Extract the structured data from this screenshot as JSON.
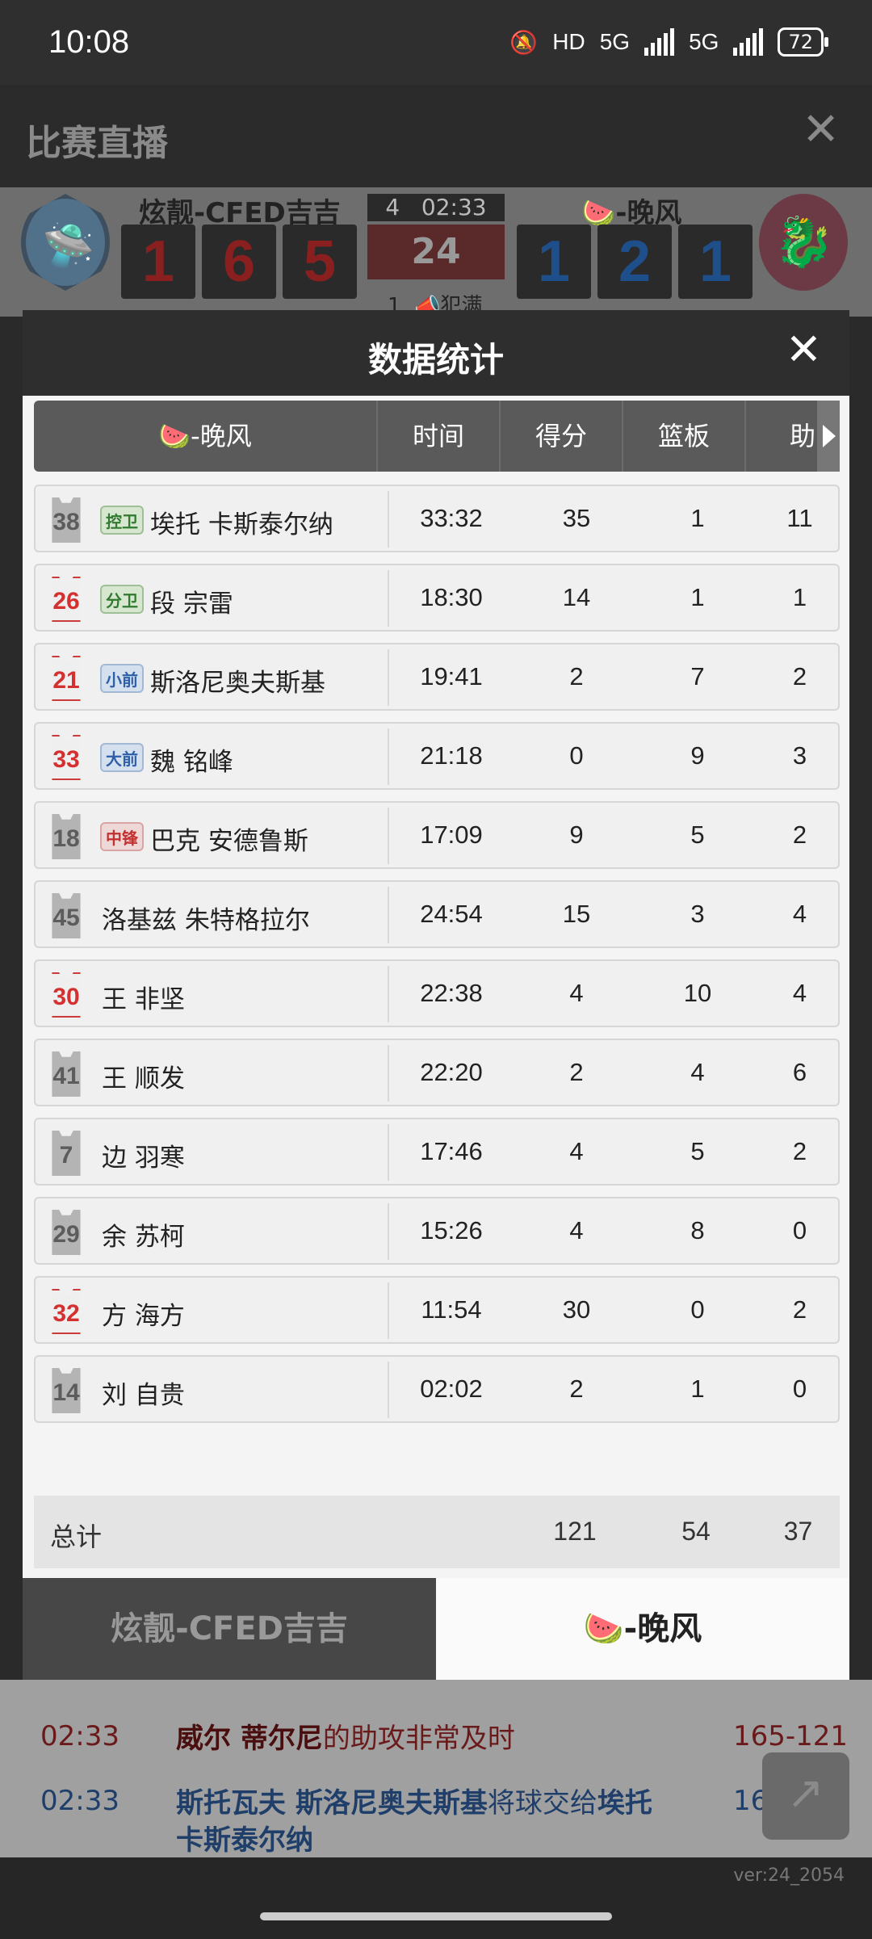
{
  "status_bar": {
    "time": "10:08",
    "icons": [
      "mute-icon",
      "hd-icon",
      "5g-signal-icon",
      "5g-signal-icon"
    ],
    "hd": "HD",
    "net1": "5G",
    "net2": "5G",
    "battery": "72"
  },
  "app": {
    "title": "比赛直播",
    "close_icon": "✕"
  },
  "scoreboard": {
    "home_name": "炫靓-CFED吉吉",
    "away_name": "🍉-晚风",
    "home_digits": [
      "1",
      "6",
      "5"
    ],
    "away_digits": [
      "1",
      "2",
      "1"
    ],
    "quarter": "4",
    "clock": "02:33",
    "shot_clock": "24",
    "foul_count": "1",
    "foul_label": "犯满"
  },
  "modal": {
    "title": "数据统计",
    "close_icon": "✕",
    "table": {
      "team_header": "🍉-晚风",
      "columns": [
        "时间",
        "得分",
        "篮板",
        "助"
      ],
      "rows": [
        {
          "number": "38",
          "jersey": "gray",
          "pos": "控卫",
          "pos_color": "green",
          "name": "埃托 卡斯泰尔纳",
          "time": "33:32",
          "pts": "35",
          "reb": "1",
          "ast": "11"
        },
        {
          "number": "26",
          "jersey": "white",
          "pos": "分卫",
          "pos_color": "green",
          "name": "段 宗雷",
          "time": "18:30",
          "pts": "14",
          "reb": "1",
          "ast": "1"
        },
        {
          "number": "21",
          "jersey": "white",
          "pos": "小前",
          "pos_color": "blue",
          "name": "斯洛尼奥夫斯基",
          "time": "19:41",
          "pts": "2",
          "reb": "7",
          "ast": "2"
        },
        {
          "number": "33",
          "jersey": "white",
          "pos": "大前",
          "pos_color": "blue",
          "name": "魏 铭峰",
          "time": "21:18",
          "pts": "0",
          "reb": "9",
          "ast": "3"
        },
        {
          "number": "18",
          "jersey": "gray",
          "pos": "中锋",
          "pos_color": "red",
          "name": "巴克 安德鲁斯",
          "time": "17:09",
          "pts": "9",
          "reb": "5",
          "ast": "2"
        },
        {
          "number": "45",
          "jersey": "gray",
          "pos": "",
          "pos_color": "",
          "name": "洛基兹 朱特格拉尔",
          "time": "24:54",
          "pts": "15",
          "reb": "3",
          "ast": "4"
        },
        {
          "number": "30",
          "jersey": "white",
          "pos": "",
          "pos_color": "",
          "name": "王 非坚",
          "time": "22:38",
          "pts": "4",
          "reb": "10",
          "ast": "4"
        },
        {
          "number": "41",
          "jersey": "gray",
          "pos": "",
          "pos_color": "",
          "name": "王 顺发",
          "time": "22:20",
          "pts": "2",
          "reb": "4",
          "ast": "6"
        },
        {
          "number": "7",
          "jersey": "gray",
          "pos": "",
          "pos_color": "",
          "name": "边 羽寒",
          "time": "17:46",
          "pts": "4",
          "reb": "5",
          "ast": "2"
        },
        {
          "number": "29",
          "jersey": "gray",
          "pos": "",
          "pos_color": "",
          "name": "余 苏柯",
          "time": "15:26",
          "pts": "4",
          "reb": "8",
          "ast": "0"
        },
        {
          "number": "32",
          "jersey": "white",
          "pos": "",
          "pos_color": "",
          "name": "方 海方",
          "time": "11:54",
          "pts": "30",
          "reb": "0",
          "ast": "2"
        },
        {
          "number": "14",
          "jersey": "gray",
          "pos": "",
          "pos_color": "",
          "name": "刘 自贵",
          "time": "02:02",
          "pts": "2",
          "reb": "1",
          "ast": "0"
        }
      ],
      "total_label": "总计",
      "total_pts": "121",
      "total_reb": "54",
      "total_ast": "37"
    },
    "tabs": {
      "home": "炫靓-CFED吉吉",
      "away": "🍉-晚风"
    }
  },
  "play_by_play": [
    {
      "time": "02:33",
      "player": "威尔 蒂尔尼",
      "text": "的助攻非常及时",
      "score": "165-121"
    },
    {
      "time": "02:33",
      "player": "斯托瓦夫 斯洛尼奥夫斯基",
      "text": "将球交给",
      "target": "埃托 卡斯泰尔纳",
      "score": "165-121"
    }
  ],
  "version": "ver:24_2054",
  "colors": {
    "accent_red": "#c23030",
    "accent_blue": "#2f5fa8",
    "position_green": "#2f7a2f"
  }
}
